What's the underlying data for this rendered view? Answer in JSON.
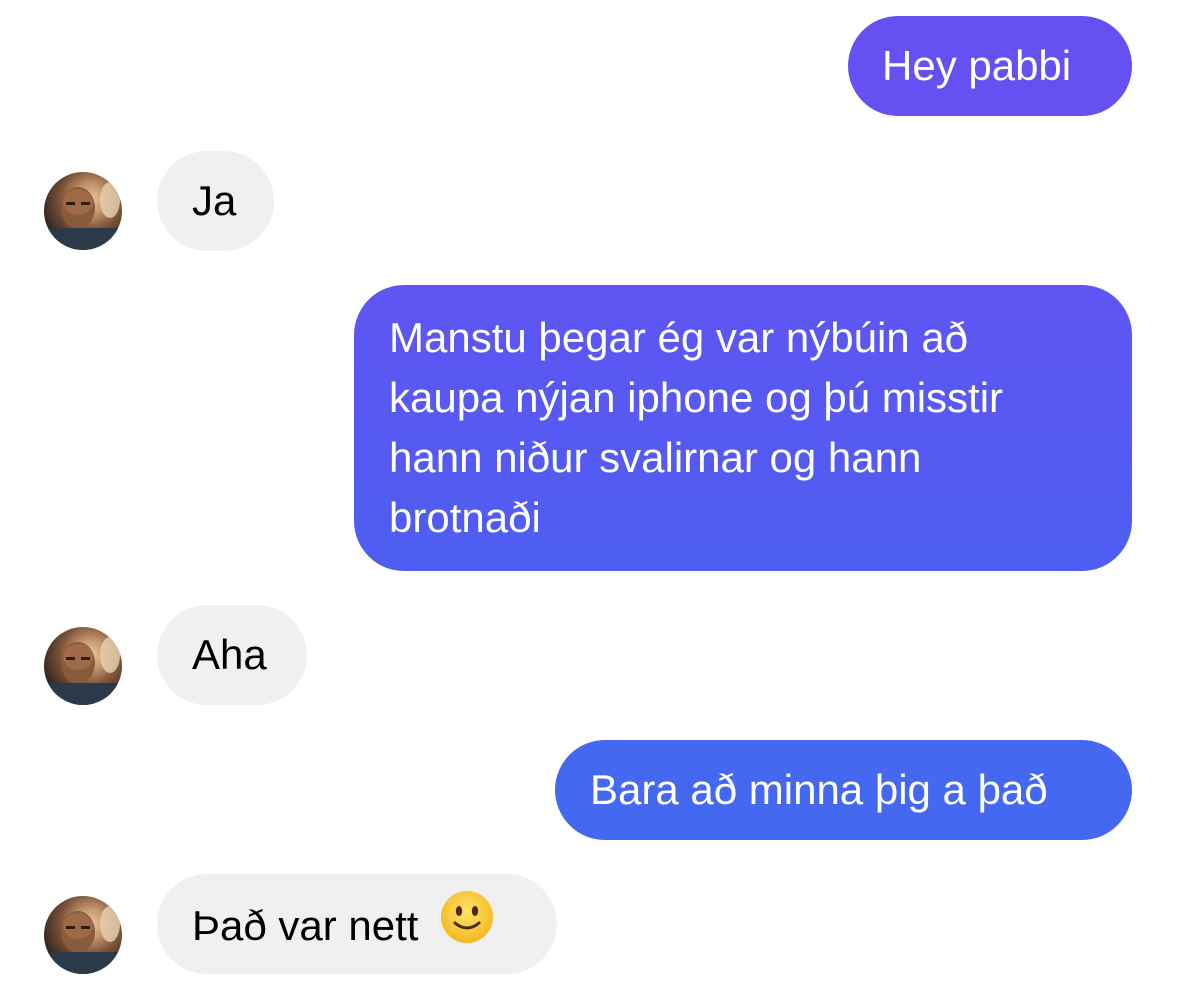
{
  "messages": [
    {
      "direction": "outgoing",
      "text": "Hey pabbi"
    },
    {
      "direction": "incoming",
      "text": "Ja"
    },
    {
      "direction": "outgoing",
      "lines": [
        "Manstu þegar ég var nýbúin að",
        "kaupa nýjan iphone og þú misstir",
        "hann niður svalirnar og hann",
        "brotnaði"
      ]
    },
    {
      "direction": "incoming",
      "text": "Aha"
    },
    {
      "direction": "outgoing",
      "text": "Bara að minna þig a það"
    },
    {
      "direction": "incoming",
      "text": "Það var nett",
      "emoji": "slightly-smiling-face-icon"
    }
  ],
  "colors": {
    "outgoing_top": "#6650f2",
    "outgoing_bottom": "#4468f0",
    "incoming_bg": "#f0f0f0",
    "emoji_face": "#f7c230"
  }
}
